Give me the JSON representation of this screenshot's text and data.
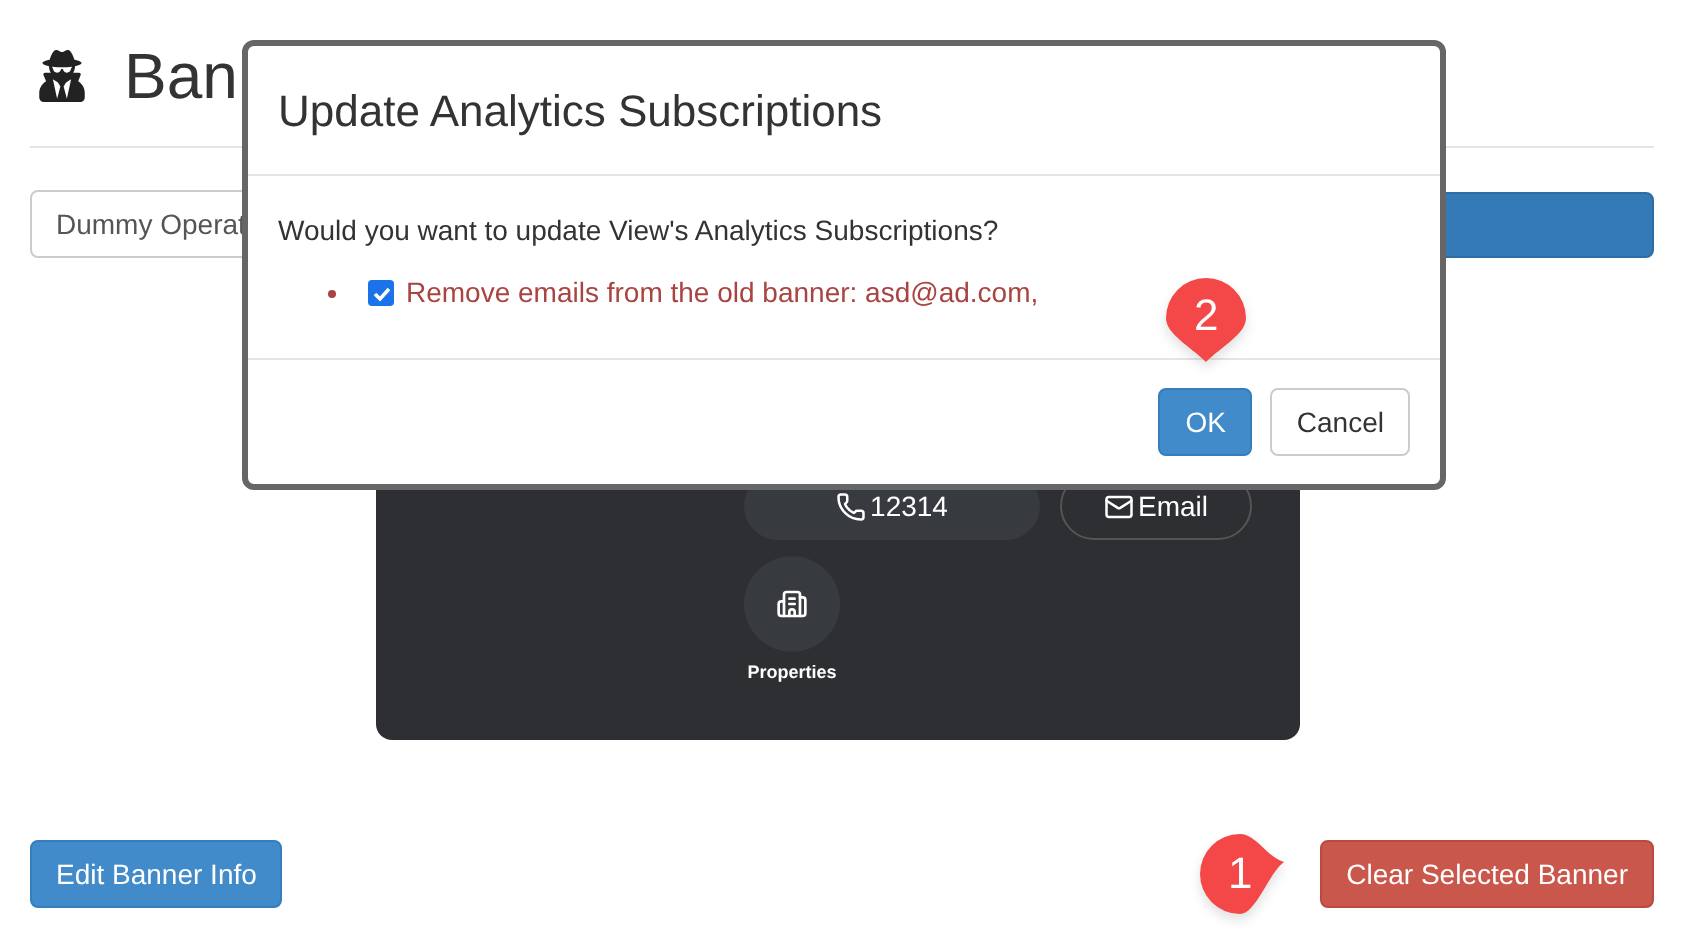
{
  "page": {
    "title": "Ban",
    "operator_select": {
      "value": "Dummy Operat"
    }
  },
  "banner_preview": {
    "phone": "12314",
    "email": "Email",
    "properties": "Properties"
  },
  "buttons": {
    "edit": "Edit Banner Info",
    "clear": "Clear Selected Banner"
  },
  "dialog": {
    "title": "Update Analytics Subscriptions",
    "message": "Would you want to update View's Analytics Subscriptions?",
    "options": [
      {
        "label": "Remove emails from the old banner: asd@ad.com,",
        "checked": true
      }
    ],
    "ok": "OK",
    "cancel": "Cancel"
  },
  "callouts": [
    {
      "number": "1",
      "kind": "right"
    },
    {
      "number": "2",
      "kind": "down"
    }
  ]
}
